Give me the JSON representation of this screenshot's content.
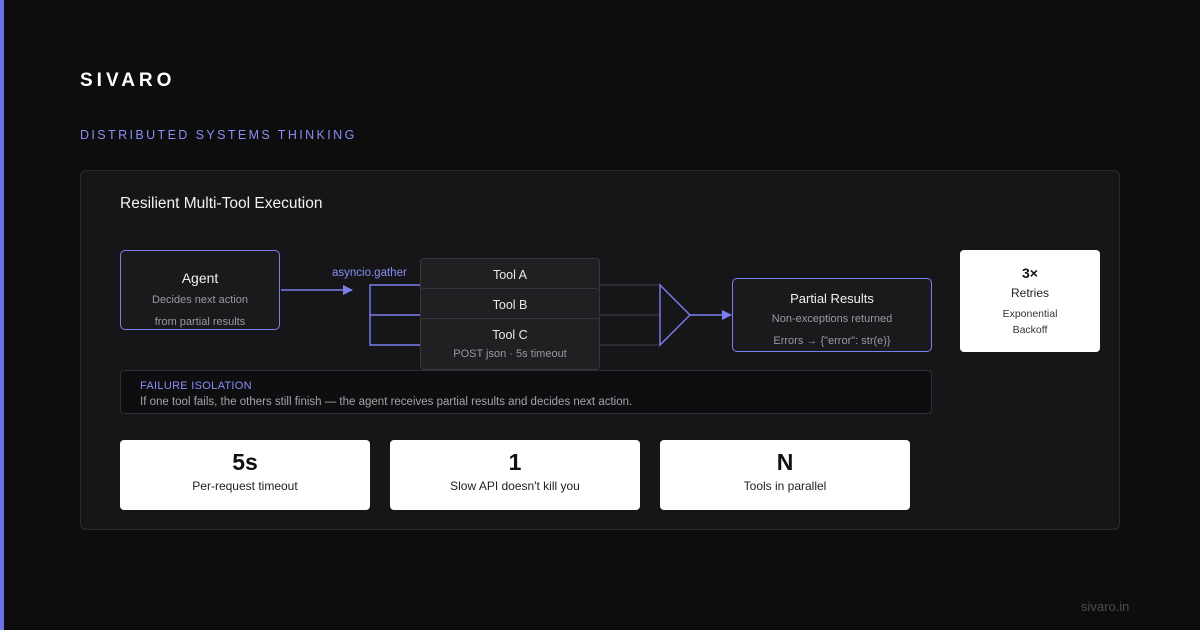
{
  "brand": "SIVARO",
  "eyebrow": "DISTRIBUTED SYSTEMS THINKING",
  "panel": {
    "title": "Resilient Multi-Tool Execution",
    "agent": {
      "title": "Agent",
      "line1": "Decides next action",
      "line2": "from partial results"
    },
    "gather_label": "asyncio.gather",
    "tools": [
      {
        "name": "Tool A",
        "detail": ""
      },
      {
        "name": "Tool B",
        "detail": ""
      },
      {
        "name": "Tool C",
        "detail": "POST json · 5s timeout"
      }
    ],
    "partial": {
      "title": "Partial Results",
      "line1": "Non-exceptions returned",
      "line2": "Errors → {\"error\": str(e)}"
    },
    "retries": {
      "value": "3×",
      "label": "Retries",
      "line1": "Exponential",
      "line2": "Backoff"
    },
    "isolation": {
      "heading": "FAILURE ISOLATION",
      "text": "If one tool fails, the others still finish — the agent receives partial results and decides next action."
    },
    "stats": [
      {
        "value": "5s",
        "label": "Per-request timeout"
      },
      {
        "value": "1",
        "label": "Slow API doesn't kill you"
      },
      {
        "value": "N",
        "label": "Tools in parallel"
      }
    ]
  },
  "footer": "sivaro.in",
  "colors": {
    "accent": "#7b7ff0",
    "accent_text": "#8a8ef5",
    "background": "#0d0d0d",
    "panel": "#161618"
  }
}
